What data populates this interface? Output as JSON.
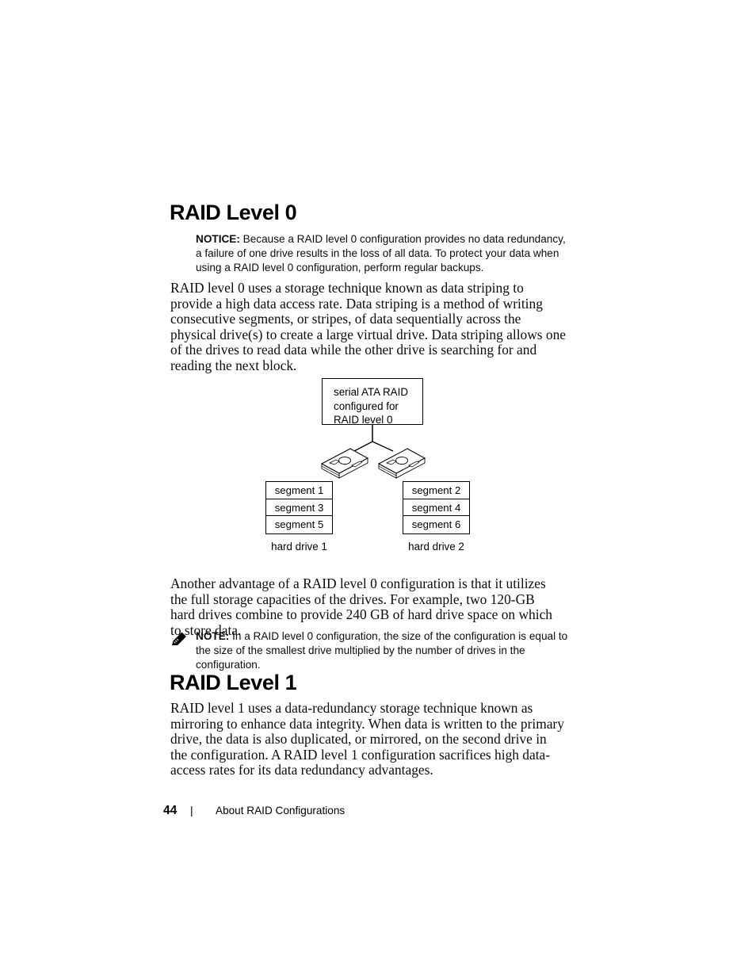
{
  "sections": [
    {
      "heading": "RAID Level 0",
      "paragraph": "RAID level 0 uses a storage technique known as data striping to provide a high data access rate. Data striping is a method of writing consecutive segments, or stripes, of data sequentially across the physical drive(s) to create a large virtual drive. Data striping allows one of the drives to read data while the other drive is searching for and reading the next block."
    },
    {
      "heading": "RAID Level 1",
      "paragraph": "RAID level 1 uses a data-redundancy storage technique known as mirroring to enhance data integrity. When data is written to the primary drive, the data is also duplicated, or mirrored, on the second drive in the configuration. A RAID level 1 configuration sacrifices high data-access rates for its data redundancy advantages."
    }
  ],
  "notice": {
    "icon": "notice-arrow-icon",
    "label": "NOTICE:",
    "text": "Because a RAID level 0 configuration provides no data redundancy, a failure of one drive results in the loss of all data. To protect your data when using a RAID level 0 configuration, perform regular backups."
  },
  "note": {
    "icon": "note-pencil-icon",
    "label": "NOTE:",
    "text": "In a RAID level 0 configuration, the size of the configuration is equal to the size of the smallest drive multiplied by the number of drives in the configuration."
  },
  "capacity_paragraph": "Another advantage of a RAID level 0 configuration is that it utilizes the full storage capacities of the drives. For example, two 120-GB hard drives combine to provide 240 GB of hard drive space on which to store data.",
  "diagram": {
    "controller_label": "serial ATA RAID\nconfigured for\nRAID level 0",
    "drives": [
      {
        "label": "hard drive 1",
        "segments": [
          "segment 1",
          "segment 3",
          "segment 5"
        ]
      },
      {
        "label": "hard drive 2",
        "segments": [
          "segment 2",
          "segment 4",
          "segment 6"
        ]
      }
    ]
  },
  "footer": {
    "page_number": "44",
    "separator": "|",
    "title": "About RAID Configurations"
  },
  "colors": {
    "text": "#000000",
    "page_background": "#ffffff",
    "rule": "#000000"
  }
}
